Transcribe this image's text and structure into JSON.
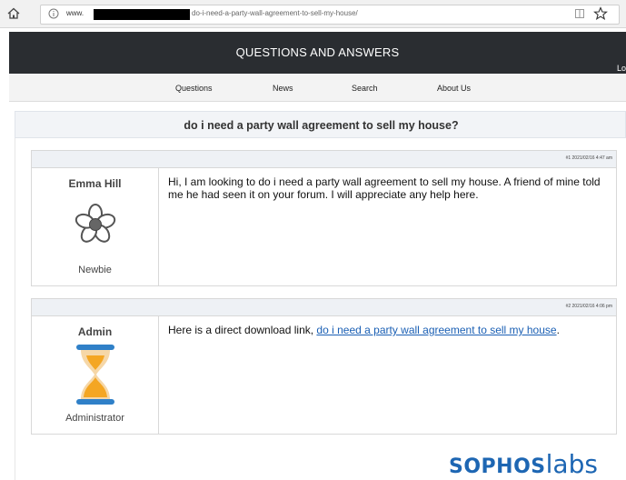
{
  "browser": {
    "url_prefix": "www.",
    "url_path": "do-i-need-a-party-wall-agreement-to-sell-my-house/",
    "icons": [
      "home-icon",
      "info-icon",
      "reader-mode-icon",
      "star-icon"
    ]
  },
  "site": {
    "title": "QUESTIONS AND ANSWERS",
    "login_label": "Lo",
    "header_color": "#2a2d31"
  },
  "nav": {
    "items": [
      "Questions",
      "News",
      "Search",
      "About Us"
    ]
  },
  "question": {
    "title": "do i need a party wall agreement to sell my house?"
  },
  "posts": [
    {
      "meta": "#1 2021/02/16 4:47 am",
      "author": "Emma Hill",
      "rank": "Newbie",
      "avatar_icon": "flower-icon",
      "body": "Hi, I am looking to do i need a party wall agreement to sell my house. A friend of mine told me he had seen it on your forum. I will appreciate any help here."
    },
    {
      "meta": "#2 2021/02/16 4:06 pm",
      "author": "Admin",
      "rank": "Administrator",
      "avatar_icon": "hourglass-icon",
      "body_prefix": "Here is a direct download link, ",
      "link_text": "do i need a party wall agreement to sell my house",
      "body_suffix": ".",
      "link_color": "#1a5fb4"
    }
  ],
  "branding": {
    "part1": "SOPHOS",
    "part2": "labs",
    "color": "#1d66b3"
  }
}
